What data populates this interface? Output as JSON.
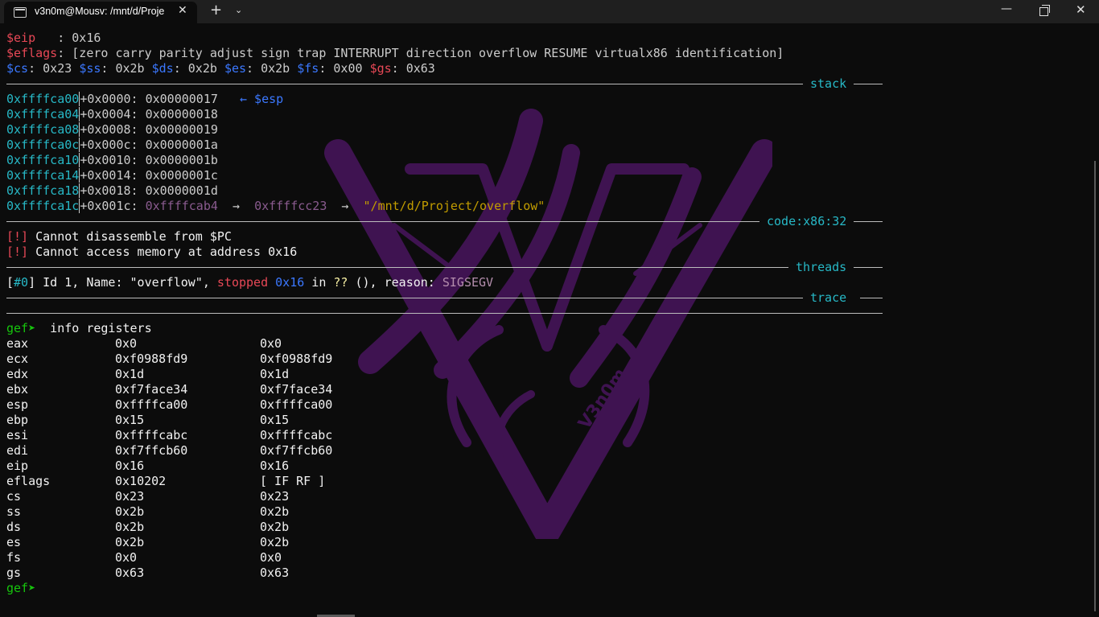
{
  "window": {
    "tab_title": "v3n0m@Mousv: /mnt/d/Proje",
    "tab_close_glyph": "✕",
    "new_tab_glyph": "+",
    "dropdown_glyph": "⌄",
    "minimize_glyph": "—",
    "close_glyph": "✕"
  },
  "watermark_text": "V3n0m",
  "regs_top": {
    "eip_name": "$eip",
    "eip_rest": "   : 0x16",
    "eflags_name": "$eflags",
    "eflags_rest": ": [zero carry parity adjust sign trap INTERRUPT direction overflow RESUME virtualx86 identification]",
    "seg": [
      {
        "name": "$cs",
        "rest": ": 0x23 "
      },
      {
        "name": "$ss",
        "rest": ": 0x2b "
      },
      {
        "name": "$ds",
        "rest": ": 0x2b "
      },
      {
        "name": "$es",
        "rest": ": 0x2b "
      },
      {
        "name": "$fs",
        "rest": ": 0x00 "
      },
      {
        "name": "$gs",
        "rest": ": 0x63"
      }
    ]
  },
  "sections": {
    "stack": "stack",
    "code": "code:x86:32",
    "threads": "threads",
    "trace": "trace"
  },
  "stack": [
    {
      "addr": "0xffffca00",
      "off": "+0x0000: ",
      "val": "0x00000017",
      "note": "   ← $esp"
    },
    {
      "addr": "0xffffca04",
      "off": "+0x0004: ",
      "val": "0x00000018"
    },
    {
      "addr": "0xffffca08",
      "off": "+0x0008: ",
      "val": "0x00000019"
    },
    {
      "addr": "0xffffca0c",
      "off": "+0x000c: ",
      "val": "0x0000001a"
    },
    {
      "addr": "0xffffca10",
      "off": "+0x0010: ",
      "val": "0x0000001b"
    },
    {
      "addr": "0xffffca14",
      "off": "+0x0014: ",
      "val": "0x0000001c"
    },
    {
      "addr": "0xffffca18",
      "off": "+0x0018: ",
      "val": "0x0000001d"
    },
    {
      "addr": "0xffffca1c",
      "off": "+0x001c: "
    }
  ],
  "stack_last": {
    "p1": "0xffffcab4",
    "arrow1": "  →  ",
    "p2": "0xffffcc23",
    "arrow2": "  →  ",
    "str": "\"/mnt/d/Project/overflow\""
  },
  "code_msgs": [
    {
      "tag": "[!]",
      "msg": " Cannot disassemble from $PC"
    },
    {
      "tag": "[!]",
      "msg": " Cannot access memory at address 0x16"
    }
  ],
  "thread": {
    "b1": "[",
    "id": "#0",
    "b2": "] Id 1, Name: \"overflow\", ",
    "state": "stopped",
    "sp": " ",
    "addr": "0x16",
    "in": " in ",
    "fn": "??",
    "rest": " (), reason: ",
    "reason": "SIGSEGV"
  },
  "prompt": "gef➤ ",
  "command": " info registers",
  "registers": [
    {
      "name": "eax",
      "hex": "0x0",
      "val": "0x0"
    },
    {
      "name": "ecx",
      "hex": "0xf0988fd9",
      "val": "0xf0988fd9"
    },
    {
      "name": "edx",
      "hex": "0x1d",
      "val": "0x1d"
    },
    {
      "name": "ebx",
      "hex": "0xf7face34",
      "val": "0xf7face34"
    },
    {
      "name": "esp",
      "hex": "0xffffca00",
      "val": "0xffffca00"
    },
    {
      "name": "ebp",
      "hex": "0x15",
      "val": "0x15"
    },
    {
      "name": "esi",
      "hex": "0xffffcabc",
      "val": "0xffffcabc"
    },
    {
      "name": "edi",
      "hex": "0xf7ffcb60",
      "val": "0xf7ffcb60"
    },
    {
      "name": "eip",
      "hex": "0x16",
      "val": "0x16"
    },
    {
      "name": "eflags",
      "hex": "0x10202",
      "val": "[ IF RF ]"
    },
    {
      "name": "cs",
      "hex": "0x23",
      "val": "0x23"
    },
    {
      "name": "ss",
      "hex": "0x2b",
      "val": "0x2b"
    },
    {
      "name": "ds",
      "hex": "0x2b",
      "val": "0x2b"
    },
    {
      "name": "es",
      "hex": "0x2b",
      "val": "0x2b"
    },
    {
      "name": "fs",
      "hex": "0x0",
      "val": "0x0"
    },
    {
      "name": "gs",
      "hex": "0x63",
      "val": "0x63"
    }
  ]
}
